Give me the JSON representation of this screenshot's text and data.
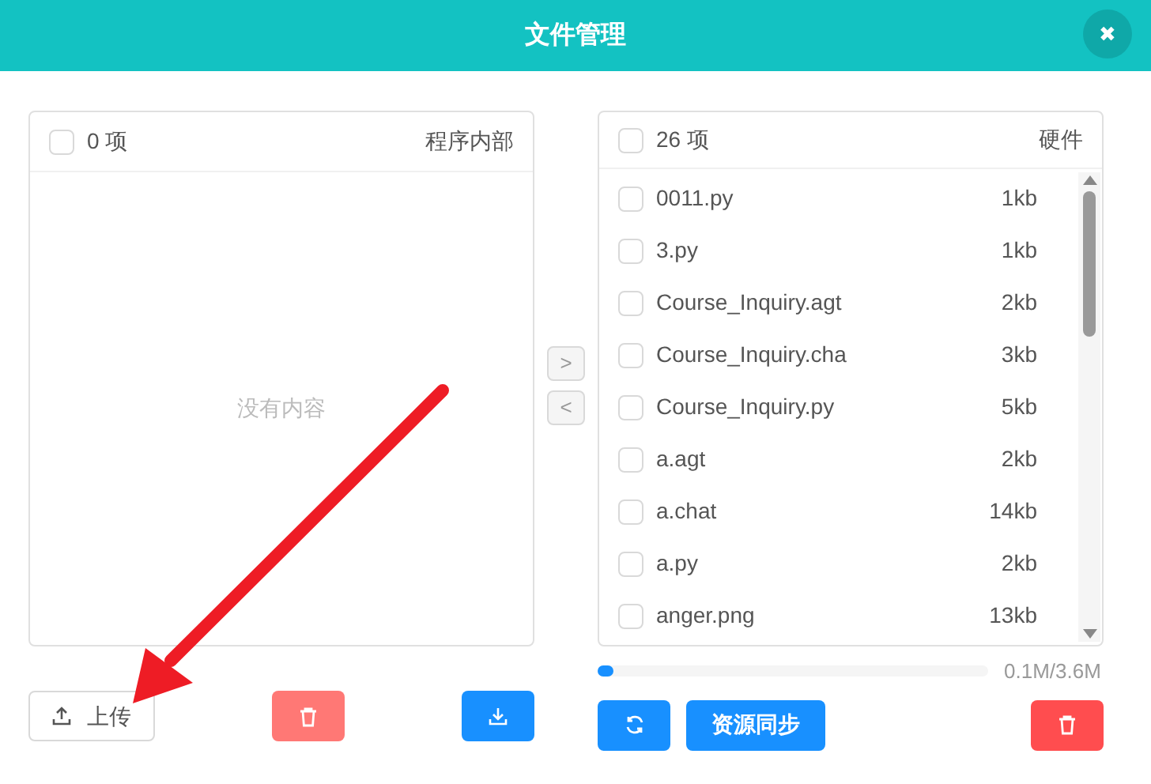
{
  "window": {
    "title": "文件管理",
    "close": "✖"
  },
  "left_panel": {
    "count": "0 项",
    "checked": false,
    "title": "程序内部",
    "empty_text": "没有内容"
  },
  "transfer": [
    {
      "label": ">",
      "disabled": false
    },
    {
      "label": "<",
      "disabled": false
    }
  ],
  "right_panel": {
    "count": "26 项",
    "checked": false,
    "title": "硬件",
    "files": [
      {
        "name": "0011.py",
        "size": "1kb",
        "checked": false
      },
      {
        "name": "3.py",
        "size": "1kb",
        "checked": false
      },
      {
        "name": "Course_Inquiry.agt",
        "size": "2kb",
        "checked": false
      },
      {
        "name": "Course_Inquiry.cha",
        "size": "3kb",
        "checked": false
      },
      {
        "name": "Course_Inquiry.py",
        "size": "5kb",
        "checked": false
      },
      {
        "name": "a.agt",
        "size": "2kb",
        "checked": false
      },
      {
        "name": "a.chat",
        "size": "14kb",
        "checked": false
      },
      {
        "name": "a.py",
        "size": "2kb",
        "checked": false
      },
      {
        "name": "anger.png",
        "size": "13kb",
        "checked": false
      }
    ]
  },
  "storage": {
    "level": 0.04,
    "reading": "0.1M/3.6M"
  },
  "left_actions": {
    "upload": "上传",
    "delete_disabled": true
  },
  "right_actions": {
    "sync": "资源同步",
    "delete_disabled": false
  }
}
